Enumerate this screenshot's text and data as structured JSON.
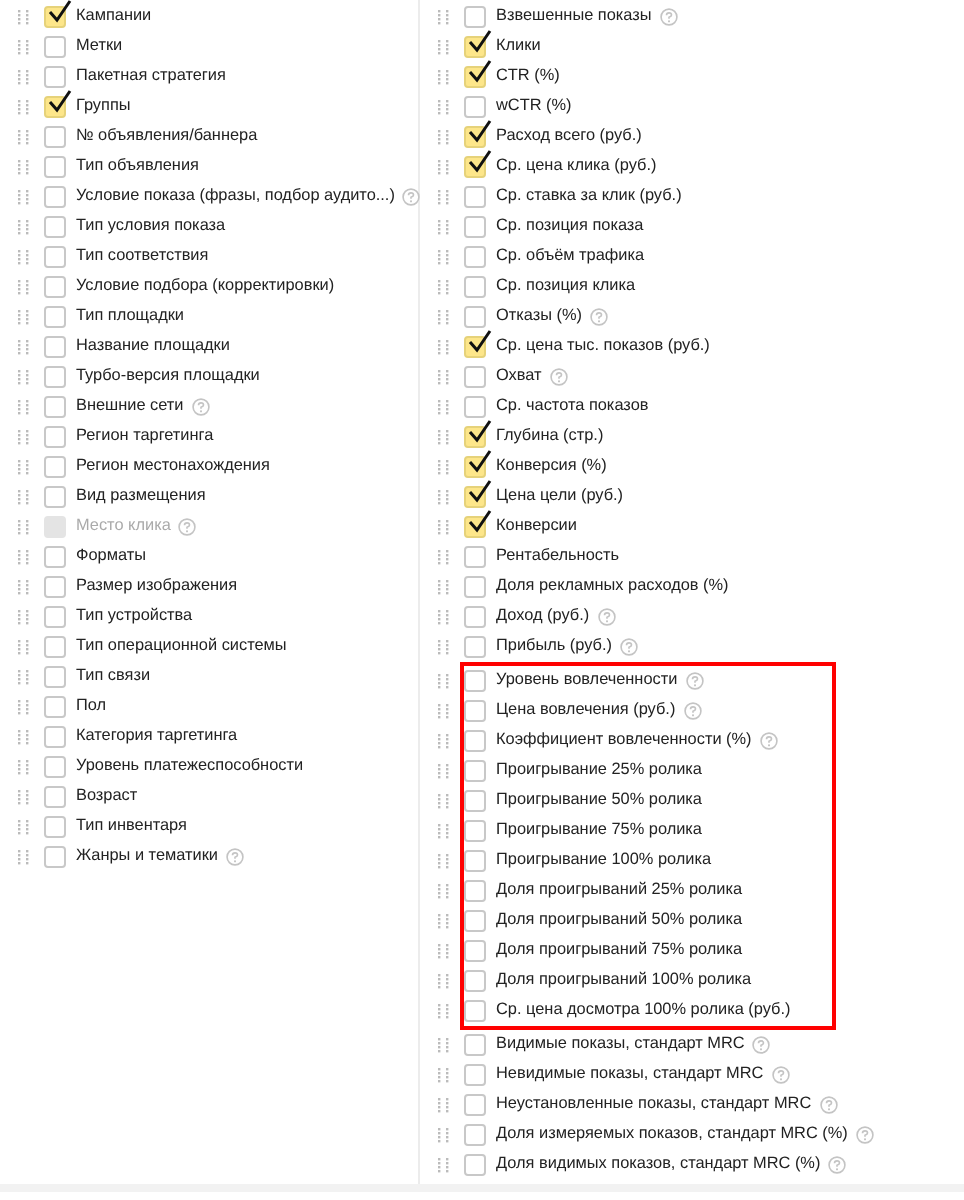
{
  "left_column": [
    {
      "label": "Кампании",
      "checked": true,
      "disabled": false,
      "help": false
    },
    {
      "label": "Метки",
      "checked": false,
      "disabled": false,
      "help": false
    },
    {
      "label": "Пакетная стратегия",
      "checked": false,
      "disabled": false,
      "help": false
    },
    {
      "label": "Группы",
      "checked": true,
      "disabled": false,
      "help": false
    },
    {
      "label": "№ объявления/баннера",
      "checked": false,
      "disabled": false,
      "help": false
    },
    {
      "label": "Тип объявления",
      "checked": false,
      "disabled": false,
      "help": false
    },
    {
      "label": "Условие показа (фразы, подбор аудито...)",
      "checked": false,
      "disabled": false,
      "help": true
    },
    {
      "label": "Тип условия показа",
      "checked": false,
      "disabled": false,
      "help": false
    },
    {
      "label": "Тип соответствия",
      "checked": false,
      "disabled": false,
      "help": false
    },
    {
      "label": "Условие подбора (корректировки)",
      "checked": false,
      "disabled": false,
      "help": false
    },
    {
      "label": "Тип площадки",
      "checked": false,
      "disabled": false,
      "help": false
    },
    {
      "label": "Название площадки",
      "checked": false,
      "disabled": false,
      "help": false
    },
    {
      "label": "Турбо-версия площадки",
      "checked": false,
      "disabled": false,
      "help": false
    },
    {
      "label": "Внешние сети",
      "checked": false,
      "disabled": false,
      "help": true
    },
    {
      "label": "Регион таргетинга",
      "checked": false,
      "disabled": false,
      "help": false
    },
    {
      "label": "Регион местонахождения",
      "checked": false,
      "disabled": false,
      "help": false
    },
    {
      "label": "Вид размещения",
      "checked": false,
      "disabled": false,
      "help": false
    },
    {
      "label": "Место клика",
      "checked": false,
      "disabled": true,
      "help": true
    },
    {
      "label": "Форматы",
      "checked": false,
      "disabled": false,
      "help": false
    },
    {
      "label": "Размер изображения",
      "checked": false,
      "disabled": false,
      "help": false
    },
    {
      "label": "Тип устройства",
      "checked": false,
      "disabled": false,
      "help": false
    },
    {
      "label": "Тип операционной системы",
      "checked": false,
      "disabled": false,
      "help": false
    },
    {
      "label": "Тип связи",
      "checked": false,
      "disabled": false,
      "help": false
    },
    {
      "label": "Пол",
      "checked": false,
      "disabled": false,
      "help": false
    },
    {
      "label": "Категория таргетинга",
      "checked": false,
      "disabled": false,
      "help": false
    },
    {
      "label": "Уровень платежеспособности",
      "checked": false,
      "disabled": false,
      "help": false
    },
    {
      "label": "Возраст",
      "checked": false,
      "disabled": false,
      "help": false
    },
    {
      "label": "Тип инвентаря",
      "checked": false,
      "disabled": false,
      "help": false
    },
    {
      "label": "Жанры и тематики",
      "checked": false,
      "disabled": false,
      "help": true
    }
  ],
  "right_column": [
    {
      "highlighted": false,
      "items": [
        {
          "label": "Взвешенные показы",
          "checked": false,
          "disabled": false,
          "help": true
        },
        {
          "label": "Клики",
          "checked": true,
          "disabled": false,
          "help": false
        },
        {
          "label": "CTR (%)",
          "checked": true,
          "disabled": false,
          "help": false
        },
        {
          "label": "wCTR (%)",
          "checked": false,
          "disabled": false,
          "help": false
        },
        {
          "label": "Расход всего (руб.)",
          "checked": true,
          "disabled": false,
          "help": false
        },
        {
          "label": "Ср. цена клика (руб.)",
          "checked": true,
          "disabled": false,
          "help": false
        },
        {
          "label": "Ср. ставка за клик (руб.)",
          "checked": false,
          "disabled": false,
          "help": false
        },
        {
          "label": "Ср. позиция показа",
          "checked": false,
          "disabled": false,
          "help": false
        },
        {
          "label": "Ср. объём трафика",
          "checked": false,
          "disabled": false,
          "help": false
        },
        {
          "label": "Ср. позиция клика",
          "checked": false,
          "disabled": false,
          "help": false
        },
        {
          "label": "Отказы (%)",
          "checked": false,
          "disabled": false,
          "help": true
        },
        {
          "label": "Ср. цена тыс. показов (руб.)",
          "checked": true,
          "disabled": false,
          "help": false
        },
        {
          "label": "Охват",
          "checked": false,
          "disabled": false,
          "help": true
        },
        {
          "label": "Ср. частота показов",
          "checked": false,
          "disabled": false,
          "help": false
        },
        {
          "label": "Глубина (стр.)",
          "checked": true,
          "disabled": false,
          "help": false
        },
        {
          "label": "Конверсия (%)",
          "checked": true,
          "disabled": false,
          "help": false
        },
        {
          "label": "Цена цели (руб.)",
          "checked": true,
          "disabled": false,
          "help": false
        },
        {
          "label": "Конверсии",
          "checked": true,
          "disabled": false,
          "help": false
        },
        {
          "label": "Рентабельность",
          "checked": false,
          "disabled": false,
          "help": false
        },
        {
          "label": "Доля рекламных расходов (%)",
          "checked": false,
          "disabled": false,
          "help": false
        },
        {
          "label": "Доход (руб.)",
          "checked": false,
          "disabled": false,
          "help": true
        },
        {
          "label": "Прибыль (руб.)",
          "checked": false,
          "disabled": false,
          "help": true
        }
      ]
    },
    {
      "highlighted": true,
      "items": [
        {
          "label": "Уровень вовлеченности",
          "checked": false,
          "disabled": false,
          "help": true
        },
        {
          "label": "Цена вовлечения (руб.)",
          "checked": false,
          "disabled": false,
          "help": true
        },
        {
          "label": "Коэффициент вовлеченности (%)",
          "checked": false,
          "disabled": false,
          "help": true
        },
        {
          "label": "Проигрывание 25% ролика",
          "checked": false,
          "disabled": false,
          "help": false
        },
        {
          "label": "Проигрывание 50% ролика",
          "checked": false,
          "disabled": false,
          "help": false
        },
        {
          "label": "Проигрывание 75% ролика",
          "checked": false,
          "disabled": false,
          "help": false
        },
        {
          "label": "Проигрывание 100% ролика",
          "checked": false,
          "disabled": false,
          "help": false
        },
        {
          "label": "Доля проигрываний 25% ролика",
          "checked": false,
          "disabled": false,
          "help": false
        },
        {
          "label": "Доля проигрываний 50% ролика",
          "checked": false,
          "disabled": false,
          "help": false
        },
        {
          "label": "Доля проигрываний 75% ролика",
          "checked": false,
          "disabled": false,
          "help": false
        },
        {
          "label": "Доля проигрываний 100% ролика",
          "checked": false,
          "disabled": false,
          "help": false
        },
        {
          "label": "Ср. цена досмотра 100% ролика (руб.)",
          "checked": false,
          "disabled": false,
          "help": false
        }
      ]
    },
    {
      "highlighted": false,
      "items": [
        {
          "label": "Видимые показы, стандарт MRC",
          "checked": false,
          "disabled": false,
          "help": true
        },
        {
          "label": "Невидимые показы, стандарт MRC",
          "checked": false,
          "disabled": false,
          "help": true
        },
        {
          "label": "Неустановленные показы, стандарт MRC",
          "checked": false,
          "disabled": false,
          "help": true
        },
        {
          "label": "Доля измеряемых показов, стандарт MRC (%)",
          "checked": false,
          "disabled": false,
          "help": true
        },
        {
          "label": "Доля видимых показов, стандарт MRC (%)",
          "checked": false,
          "disabled": false,
          "help": true
        }
      ]
    }
  ]
}
